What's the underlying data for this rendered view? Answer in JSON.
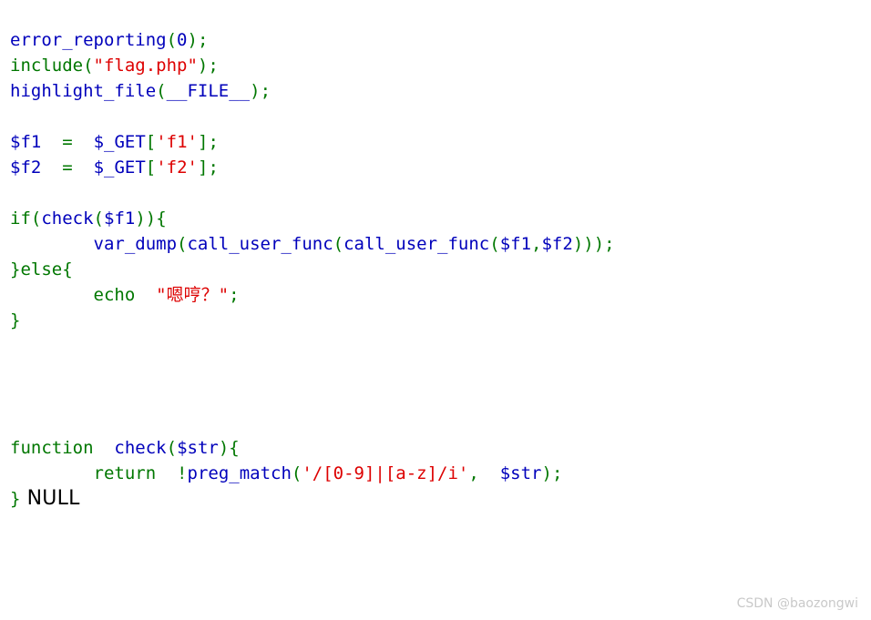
{
  "page": {
    "background": "#ffffff",
    "watermark": "CSDN @baozongwi"
  },
  "colors": {
    "identifier": "#0000BB",
    "keyword": "#007700",
    "string": "#DD0000",
    "plain_text": "#000000",
    "watermark": "#c9c9c9"
  },
  "code": {
    "language": "php",
    "lines": [
      {
        "id": "line-1",
        "tokens": [
          {
            "text": "error_reporting",
            "type": "identifier"
          },
          {
            "text": "(",
            "type": "keyword"
          },
          {
            "text": "0",
            "type": "identifier"
          },
          {
            "text": ")",
            "type": "keyword"
          },
          {
            "text": ";",
            "type": "keyword"
          }
        ]
      },
      {
        "id": "line-2",
        "tokens": [
          {
            "text": "include",
            "type": "keyword"
          },
          {
            "text": "(",
            "type": "keyword"
          },
          {
            "text": "\"flag.php\"",
            "type": "string"
          },
          {
            "text": ")",
            "type": "keyword"
          },
          {
            "text": ";",
            "type": "keyword"
          }
        ]
      },
      {
        "id": "line-3",
        "tokens": [
          {
            "text": "highlight_file",
            "type": "identifier"
          },
          {
            "text": "(",
            "type": "keyword"
          },
          {
            "text": "__FILE__",
            "type": "identifier"
          },
          {
            "text": ")",
            "type": "keyword"
          },
          {
            "text": ";",
            "type": "keyword"
          }
        ]
      },
      {
        "id": "line-4",
        "tokens": []
      },
      {
        "id": "line-5",
        "tokens": [
          {
            "text": "$f1",
            "type": "identifier"
          },
          {
            "text": "  ",
            "type": "identifier"
          },
          {
            "text": "=",
            "type": "keyword"
          },
          {
            "text": "  ",
            "type": "identifier"
          },
          {
            "text": "$_GET",
            "type": "identifier"
          },
          {
            "text": "[",
            "type": "keyword"
          },
          {
            "text": "'f1'",
            "type": "string"
          },
          {
            "text": "]",
            "type": "keyword"
          },
          {
            "text": ";",
            "type": "keyword"
          }
        ]
      },
      {
        "id": "line-6",
        "tokens": [
          {
            "text": "$f2",
            "type": "identifier"
          },
          {
            "text": "  ",
            "type": "identifier"
          },
          {
            "text": "=",
            "type": "keyword"
          },
          {
            "text": "  ",
            "type": "identifier"
          },
          {
            "text": "$_GET",
            "type": "identifier"
          },
          {
            "text": "[",
            "type": "keyword"
          },
          {
            "text": "'f2'",
            "type": "string"
          },
          {
            "text": "]",
            "type": "keyword"
          },
          {
            "text": ";",
            "type": "keyword"
          }
        ]
      },
      {
        "id": "line-7",
        "tokens": []
      },
      {
        "id": "line-8",
        "tokens": [
          {
            "text": "if",
            "type": "keyword"
          },
          {
            "text": "(",
            "type": "keyword"
          },
          {
            "text": "check",
            "type": "identifier"
          },
          {
            "text": "(",
            "type": "keyword"
          },
          {
            "text": "$f1",
            "type": "identifier"
          },
          {
            "text": "))",
            "type": "keyword"
          },
          {
            "text": "{",
            "type": "keyword"
          }
        ]
      },
      {
        "id": "line-9",
        "tokens": [
          {
            "text": "        ",
            "type": "identifier"
          },
          {
            "text": "var_dump",
            "type": "identifier"
          },
          {
            "text": "(",
            "type": "keyword"
          },
          {
            "text": "call_user_func",
            "type": "identifier"
          },
          {
            "text": "(",
            "type": "keyword"
          },
          {
            "text": "call_user_func",
            "type": "identifier"
          },
          {
            "text": "(",
            "type": "keyword"
          },
          {
            "text": "$f1",
            "type": "identifier"
          },
          {
            "text": ",",
            "type": "keyword"
          },
          {
            "text": "$f2",
            "type": "identifier"
          },
          {
            "text": ")))",
            "type": "keyword"
          },
          {
            "text": ";",
            "type": "keyword"
          }
        ]
      },
      {
        "id": "line-10",
        "tokens": [
          {
            "text": "}",
            "type": "keyword"
          },
          {
            "text": "else",
            "type": "keyword"
          },
          {
            "text": "{",
            "type": "keyword"
          }
        ]
      },
      {
        "id": "line-11",
        "tokens": [
          {
            "text": "        ",
            "type": "identifier"
          },
          {
            "text": "echo",
            "type": "keyword"
          },
          {
            "text": "  ",
            "type": "identifier"
          },
          {
            "text": "\"嗯哼？\"",
            "type": "string"
          },
          {
            "text": ";",
            "type": "keyword"
          }
        ]
      },
      {
        "id": "line-12",
        "tokens": [
          {
            "text": "}",
            "type": "keyword"
          }
        ]
      },
      {
        "id": "line-13",
        "tokens": []
      },
      {
        "id": "line-14",
        "tokens": []
      },
      {
        "id": "line-15",
        "tokens": []
      },
      {
        "id": "line-16",
        "tokens": []
      },
      {
        "id": "line-17",
        "tokens": [
          {
            "text": "function",
            "type": "keyword"
          },
          {
            "text": "  ",
            "type": "identifier"
          },
          {
            "text": "check",
            "type": "identifier"
          },
          {
            "text": "(",
            "type": "keyword"
          },
          {
            "text": "$str",
            "type": "identifier"
          },
          {
            "text": ")",
            "type": "keyword"
          },
          {
            "text": "{",
            "type": "keyword"
          }
        ]
      },
      {
        "id": "line-18",
        "tokens": [
          {
            "text": "        ",
            "type": "identifier"
          },
          {
            "text": "return",
            "type": "keyword"
          },
          {
            "text": "  ",
            "type": "identifier"
          },
          {
            "text": "!",
            "type": "keyword"
          },
          {
            "text": "preg_match",
            "type": "identifier"
          },
          {
            "text": "(",
            "type": "keyword"
          },
          {
            "text": "'/[0-9]|[a-z]/i'",
            "type": "string"
          },
          {
            "text": ",",
            "type": "keyword"
          },
          {
            "text": "  ",
            "type": "identifier"
          },
          {
            "text": "$str",
            "type": "identifier"
          },
          {
            "text": ")",
            "type": "keyword"
          },
          {
            "text": ";",
            "type": "keyword"
          }
        ]
      },
      {
        "id": "line-19",
        "tokens": [
          {
            "text": "}",
            "type": "keyword"
          }
        ],
        "trailing_output": " NULL"
      }
    ]
  }
}
